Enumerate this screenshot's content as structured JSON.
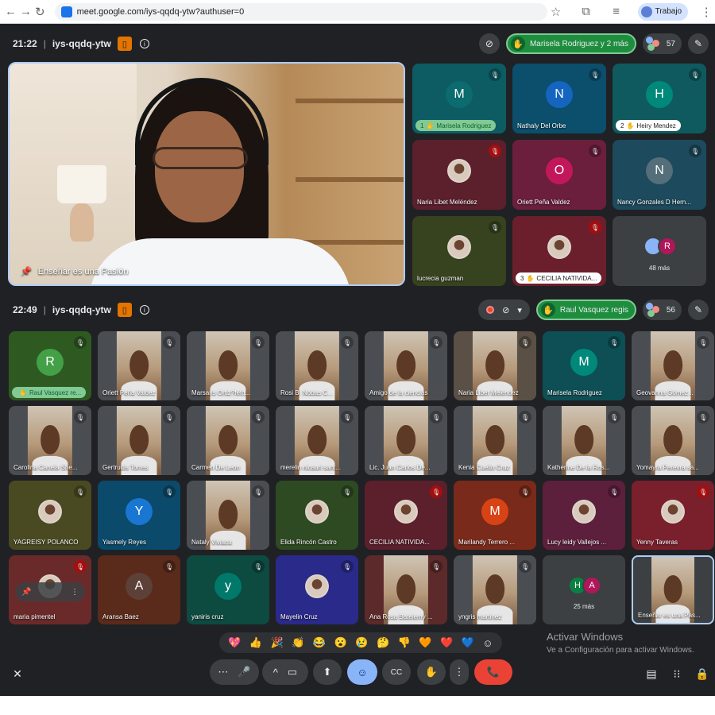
{
  "browser": {
    "url": "meet.google.com/iys-qqdq-ytw?authuser=0",
    "profile_label": "Trabajo"
  },
  "meeting_a": {
    "time": "21:22",
    "code": "iys-qqdq-ytw",
    "hand_pill": "Marisela Rodriguez y 2 más",
    "participants_count": "57",
    "presenter_label": "Enseñar es una Pasión",
    "tiles": [
      {
        "kind": "avatar",
        "letter": "M",
        "color": "#0b6b6e",
        "bg": "#0d5c63",
        "name": "Marisela Rodriguez",
        "badge": "1",
        "badge_style": "g",
        "mic": "off"
      },
      {
        "kind": "avatar",
        "letter": "N",
        "color": "#1565c0",
        "bg": "#0b4f6c",
        "name": "Nathaly Del Orbe",
        "mic": "off"
      },
      {
        "kind": "avatar",
        "letter": "H",
        "color": "#00897b",
        "bg": "#0e5a5f",
        "name": "Heiry Mendez",
        "badge": "2",
        "badge_style": "w",
        "mic": "off"
      },
      {
        "kind": "thumb",
        "bg": "#5c1f2c",
        "name": "Naria Libet Meléndez",
        "mic": "off-red"
      },
      {
        "kind": "avatar",
        "letter": "O",
        "color": "#c2185b",
        "bg": "#6b1f3c",
        "name": "Oriett Peña Valdez",
        "mic": "off"
      },
      {
        "kind": "avatar",
        "letter": "N",
        "color": "#546e7a",
        "bg": "#1d4a5c",
        "name": "Nancy Gonzales D Hern...",
        "mic": "off"
      },
      {
        "kind": "thumb",
        "bg": "#37421f",
        "name": "lucrecia guzman",
        "mic": "off"
      },
      {
        "kind": "thumb",
        "bg": "#6b1f2c",
        "name": "CECILIA NATIVIDA...",
        "badge": "3",
        "badge_style": "w",
        "mic": "off-red"
      },
      {
        "kind": "more",
        "bg": "#3c4043",
        "letters": [
          "",
          "R"
        ],
        "label": "48 más"
      }
    ]
  },
  "meeting_b": {
    "time": "22:49",
    "code": "iys-qqdq-ytw",
    "hand_pill": "Raul Vasquez regis",
    "participants_count": "56",
    "tiles": [
      {
        "kind": "avatar",
        "letter": "R",
        "color": "#43a047",
        "bg": "#2e5a22",
        "name": "Raul Vasquez re...",
        "badge": "",
        "badge_style": "g",
        "mic": "off"
      },
      {
        "kind": "video",
        "bg": "#4a4d52",
        "name": "Oriett Peña Valdez",
        "mic": "off"
      },
      {
        "kind": "video",
        "bg": "#4a4d52",
        "name": "Marsaris Ortiz?fefg...",
        "mic": "off"
      },
      {
        "kind": "video",
        "bg": "#4a4d52",
        "name": "Rosi B. Nobas C...",
        "mic": "off"
      },
      {
        "kind": "video",
        "bg": "#4a4d52",
        "name": "Amigo de la ciencias",
        "mic": "off"
      },
      {
        "kind": "video",
        "bg": "#5a5046",
        "name": "Naria Libet Meléndez",
        "mic": "off"
      },
      {
        "kind": "avatar",
        "letter": "M",
        "color": "#00897b",
        "bg": "#0d4f55",
        "name": "Marisela Rodriguez",
        "mic": "off"
      },
      {
        "kind": "video",
        "bg": "#4a4d52",
        "name": "Geovanna Gómez...",
        "mic": "off"
      },
      {
        "kind": "video",
        "bg": "#4a4d52",
        "name": "Carolina Canela She...",
        "mic": "off"
      },
      {
        "kind": "video",
        "bg": "#4a4d52",
        "name": "Gertrudis Torres",
        "mic": "off"
      },
      {
        "kind": "video",
        "bg": "#4a4d52",
        "name": "Carmen De Leon",
        "mic": "off"
      },
      {
        "kind": "video",
        "bg": "#4a4d52",
        "name": "merelin nicauri sant...",
        "mic": "off"
      },
      {
        "kind": "video",
        "bg": "#4a4d52",
        "name": "Lic. Juan Carlos De...",
        "mic": "off"
      },
      {
        "kind": "video",
        "bg": "#4a4d52",
        "name": "Kenia Cuello Cruz",
        "mic": "off"
      },
      {
        "kind": "video",
        "bg": "#4a4d52",
        "name": "Katherine De la Ros...",
        "mic": "off"
      },
      {
        "kind": "video",
        "bg": "#4a4d52",
        "name": "Yomayra Pereyra sa...",
        "mic": "off"
      },
      {
        "kind": "thumb",
        "bg": "#4a4a22",
        "name": "YAGREISY POLANCO",
        "mic": "off"
      },
      {
        "kind": "avatar",
        "letter": "Y",
        "color": "#1976d2",
        "bg": "#0b4a6a",
        "name": "Yasmely Reyes",
        "mic": "off"
      },
      {
        "kind": "video",
        "bg": "#4a4d52",
        "name": "Nataly Viviaca",
        "mic": "off"
      },
      {
        "kind": "thumb",
        "bg": "#2e4a22",
        "name": "Elida Rincón Castro",
        "mic": "off"
      },
      {
        "kind": "thumb",
        "bg": "#5c1f2c",
        "name": "CECILIA NATIVIDA...",
        "mic": "off-red"
      },
      {
        "kind": "avatar",
        "letter": "M",
        "color": "#d84315",
        "bg": "#7a2a1a",
        "name": "Marilandy Terrero ...",
        "mic": "off"
      },
      {
        "kind": "thumb",
        "bg": "#5c1f3c",
        "name": "Lucy leidy Vallejos ...",
        "mic": "off"
      },
      {
        "kind": "thumb",
        "bg": "#7a1f2c",
        "name": "Yenny Taveras",
        "mic": "off-red"
      },
      {
        "kind": "thumb",
        "bg": "#6b2a2a",
        "name": "maria pimentel",
        "mic": "off-red",
        "pinned": true
      },
      {
        "kind": "avatar",
        "letter": "A",
        "color": "#5d4037",
        "bg": "#5a2a1a",
        "name": "Aransa Baez",
        "mic": "off"
      },
      {
        "kind": "avatar",
        "letter": "y",
        "color": "#00796b",
        "bg": "#0d4a40",
        "name": "yaniris cruz",
        "mic": "off"
      },
      {
        "kind": "thumb",
        "bg": "#2a2a8a",
        "name": "Mayelin Cruz",
        "mic": "off"
      },
      {
        "kind": "video",
        "bg": "#5c2a2a",
        "name": "Ana Rosa Batelemy ...",
        "mic": "off"
      },
      {
        "kind": "video",
        "bg": "#4a4d52",
        "name": "yngris martinez",
        "mic": "off"
      },
      {
        "kind": "more",
        "bg": "#3c4043",
        "letters": [
          "H",
          "A"
        ],
        "label": "25 más"
      },
      {
        "kind": "video",
        "bg": "#3c4043",
        "name": "Enseñar es una Pas...",
        "mic": "",
        "highlight": true
      }
    ]
  },
  "reactions": [
    "💖",
    "👍",
    "🎉",
    "👏",
    "😂",
    "😮",
    "😢",
    "🤔",
    "👎",
    "🧡",
    "❤️",
    "💙",
    "☺"
  ],
  "watermark": {
    "line1": "Activar Windows",
    "line2": "Ve a Configuración para activar Windows."
  },
  "controls": {
    "more_dots": "⋯",
    "mic": "🎤",
    "chevron": "^",
    "camera": "▭",
    "present": "⬆",
    "emoji": "☺",
    "captions": "CC",
    "raise_hand": "✋",
    "more_options": "⋮",
    "leave": "📞"
  },
  "colors": {
    "meet_bg": "#202124",
    "tile_default": "#3c4043",
    "accent": "#8ab4f8",
    "leave_red": "#ea4335",
    "hand_green": "#1e8e3e"
  }
}
